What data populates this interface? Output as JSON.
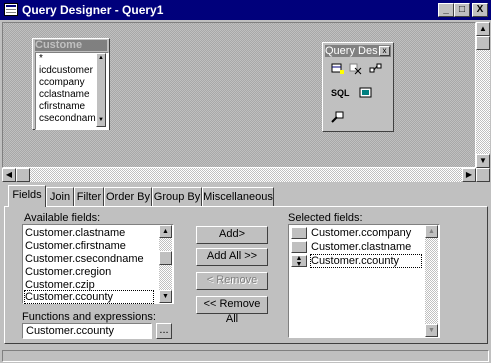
{
  "window": {
    "title": "Query Designer - Query1",
    "minimize": "_",
    "maximize": "□",
    "close": "X"
  },
  "table_window": {
    "title": "Custome",
    "fields": [
      "*",
      "icdcustomer",
      "ccompany",
      "cclastname",
      "cfirstname",
      "csecondname"
    ]
  },
  "toolbar": {
    "title": "Query Des",
    "close": "x",
    "sql_label": "SQL"
  },
  "tabs": [
    "Fields",
    "Join",
    "Filter",
    "Order By",
    "Group By",
    "Miscellaneous"
  ],
  "available_fields": {
    "label": "Available fields:",
    "items": [
      "Customer.clastname",
      "Customer.cfirstname",
      "Customer.csecondname",
      "Customer.cregion",
      "Customer.czip",
      "Customer.ccounty"
    ],
    "selected": "Customer.ccounty"
  },
  "functions": {
    "label": "Functions and expressions:",
    "value": "Customer.ccounty",
    "browse": "..."
  },
  "buttons": {
    "add": "Add>",
    "add_all": "Add All >>",
    "remove": "< Remove",
    "remove_all": "<< Remove All"
  },
  "selected_fields": {
    "label": "Selected fields:",
    "items": [
      "Customer.ccompany",
      "Customer.clastname",
      "Customer.ccounty"
    ]
  },
  "colors": {
    "titlebar": "#00007b",
    "face": "#c0c0c0",
    "window": "#ffffff"
  }
}
